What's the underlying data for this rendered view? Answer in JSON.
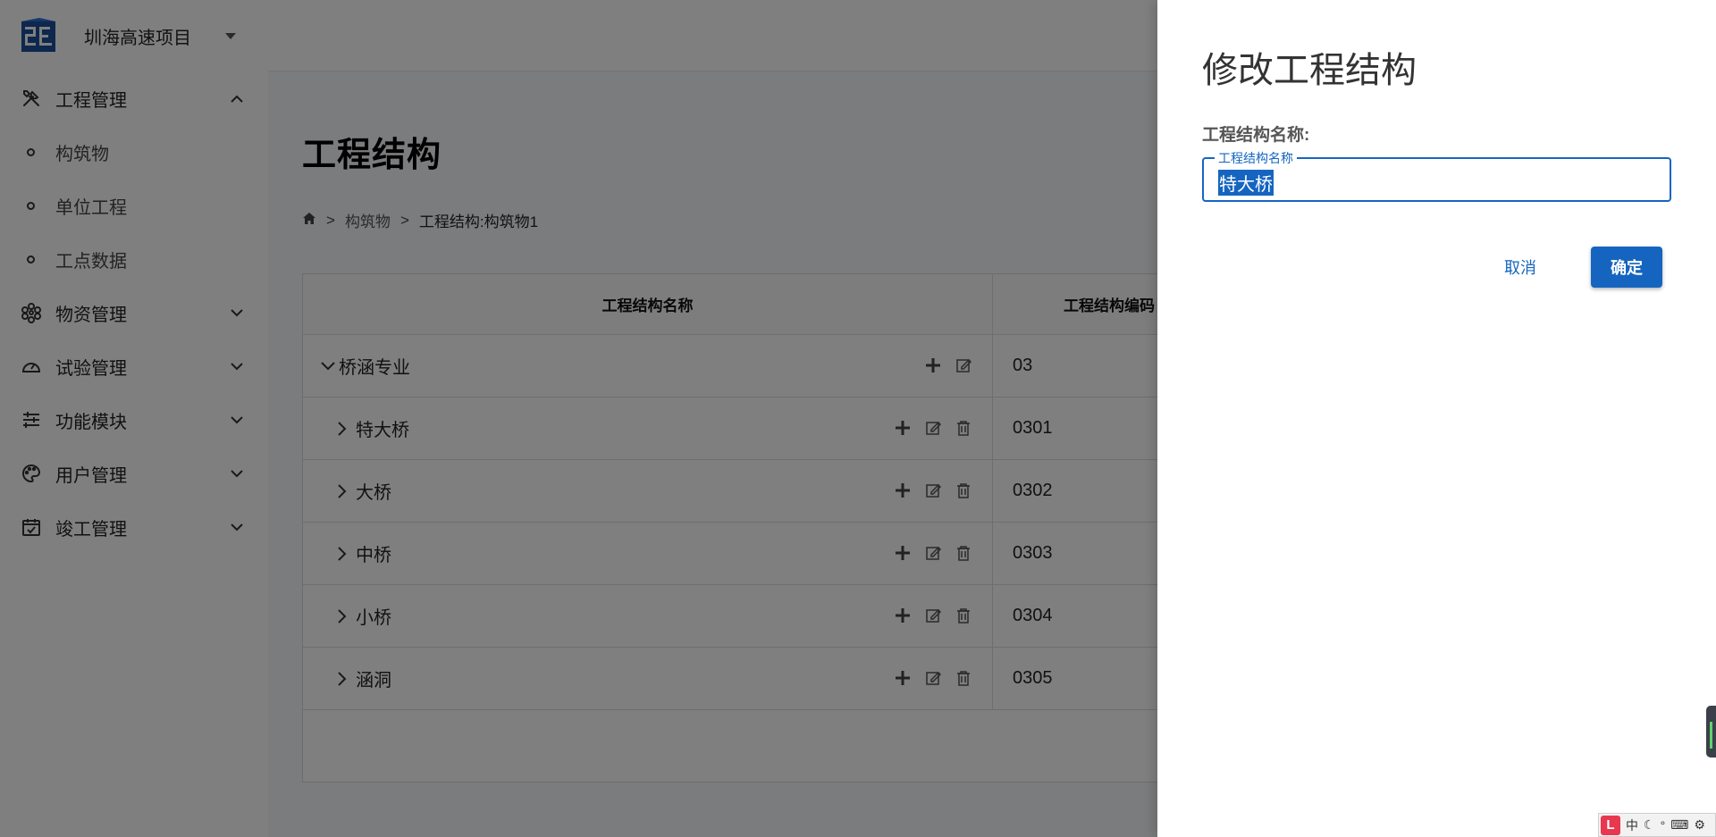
{
  "app": {
    "project_name": "圳海高速项目"
  },
  "sidebar": {
    "items": [
      {
        "label": "工程管理",
        "icon": "tools-icon",
        "expanded": true
      },
      {
        "label": "构筑物"
      },
      {
        "label": "单位工程"
      },
      {
        "label": "工点数据"
      },
      {
        "label": "物资管理",
        "icon": "molecule-icon",
        "expanded": false
      },
      {
        "label": "试验管理",
        "icon": "gauge-icon",
        "expanded": false
      },
      {
        "label": "功能模块",
        "icon": "sliders-icon",
        "expanded": false
      },
      {
        "label": "用户管理",
        "icon": "palette-icon",
        "expanded": false
      },
      {
        "label": "竣工管理",
        "icon": "calendar-check-icon",
        "expanded": false
      }
    ]
  },
  "page": {
    "title": "工程结构",
    "breadcrumb": {
      "home_icon": "home-icon",
      "separator": ">",
      "items": [
        "构筑物",
        "工程结构:构筑物1"
      ]
    }
  },
  "table": {
    "columns": [
      "工程结构名称",
      "工程结构编码"
    ],
    "rows": [
      {
        "name": "桥涵专业",
        "code": "03",
        "expanded": true,
        "deletable": false
      },
      {
        "name": "特大桥",
        "code": "0301",
        "expanded": false,
        "deletable": true
      },
      {
        "name": "大桥",
        "code": "0302",
        "expanded": false,
        "deletable": true
      },
      {
        "name": "中桥",
        "code": "0303",
        "expanded": false,
        "deletable": true
      },
      {
        "name": "小桥",
        "code": "0304",
        "expanded": false,
        "deletable": true
      },
      {
        "name": "涵洞",
        "code": "0305",
        "expanded": false,
        "deletable": true
      }
    ]
  },
  "drawer": {
    "title": "修改工程结构",
    "field_label": "工程结构名称:",
    "field_legend": "工程结构名称",
    "field_value": "特大桥",
    "cancel_label": "取消",
    "ok_label": "确定"
  },
  "ime": {
    "logo": "L",
    "mode": "中"
  },
  "colors": {
    "primary": "#1565c0",
    "overlay": "rgba(0,0,0,0.5)",
    "sidebar_text": "#222222"
  }
}
